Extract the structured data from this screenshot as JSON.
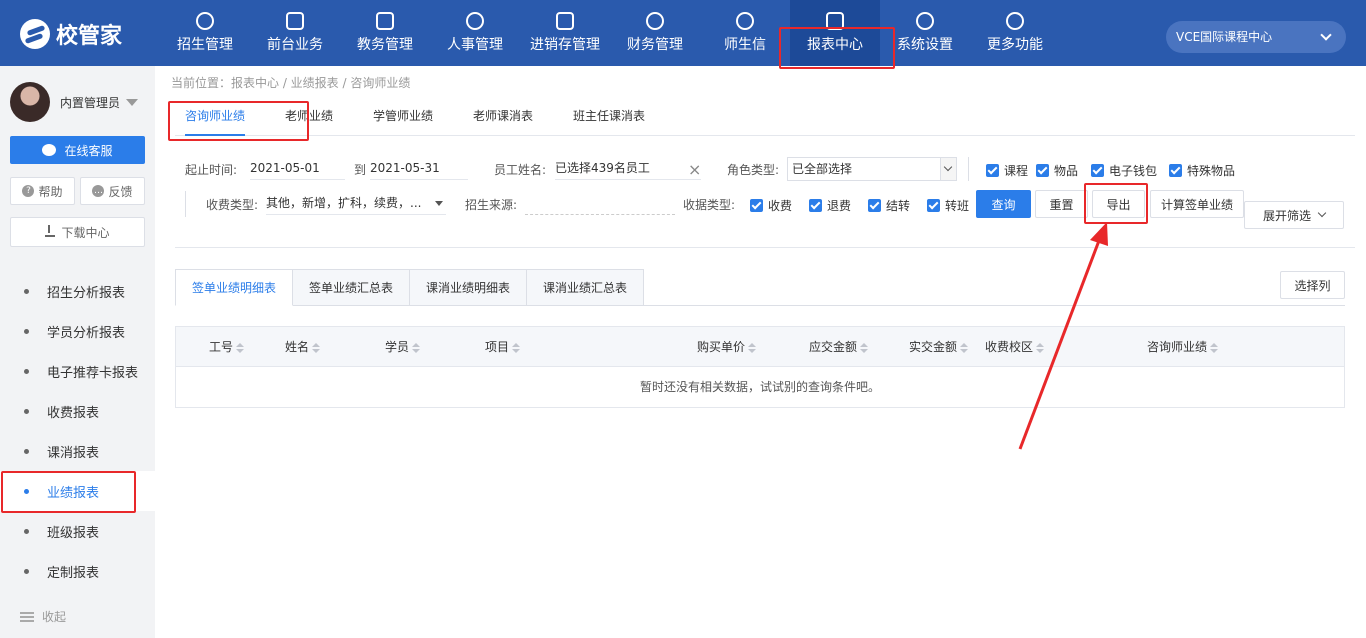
{
  "brand": {
    "name": "校管家"
  },
  "nav": {
    "items": [
      {
        "label": "招生管理",
        "icon": "person-add-icon"
      },
      {
        "label": "前台业务",
        "icon": "monitor-icon"
      },
      {
        "label": "教务管理",
        "icon": "book-icon"
      },
      {
        "label": "人事管理",
        "icon": "person-icon"
      },
      {
        "label": "进销存管理",
        "icon": "arrow-box-icon"
      },
      {
        "label": "财务管理",
        "icon": "yen-icon"
      },
      {
        "label": "师生信",
        "icon": "chat-bubble-icon"
      },
      {
        "label": "报表中心",
        "icon": "chart-icon"
      },
      {
        "label": "系统设置",
        "icon": "gear-icon"
      },
      {
        "label": "更多功能",
        "icon": "more-icon"
      }
    ],
    "active": "报表中心",
    "campus": "VCE国际课程中心"
  },
  "sidebar": {
    "user": "内置管理员",
    "service_button": "在线客服",
    "help": "帮助",
    "feedback": "反馈",
    "download": "下载中心",
    "menu": [
      "招生分析报表",
      "学员分析报表",
      "电子推荐卡报表",
      "收费报表",
      "课消报表",
      "业绩报表",
      "班级报表",
      "定制报表"
    ],
    "active_menu": "业绩报表",
    "collapse": "收起"
  },
  "breadcrumb": "当前位置：报表中心 / 业绩报表 / 咨询师业绩",
  "subtabs": [
    "咨询师业绩",
    "老师业绩",
    "学管师业绩",
    "老师课消表",
    "班主任课消表"
  ],
  "filters": {
    "date_label": "起止时间:",
    "date_from": "2021-05-01",
    "date_to_label": "到",
    "date_to": "2021-05-31",
    "staff_label": "员工姓名:",
    "staff_value": "已选择439名员工",
    "role_label": "角色类型:",
    "role_value": "已全部选择",
    "item_checks": [
      "课程",
      "物品",
      "电子钱包",
      "特殊物品"
    ],
    "fee_type_label": "收费类型:",
    "fee_type_value": "其他，新增，扩科，续费，...",
    "source_label": "招生来源:",
    "source_value": "",
    "data_type_label": "收据类型:",
    "data_type_checks": [
      "收费",
      "退费",
      "结转",
      "转班"
    ]
  },
  "buttons": {
    "query": "查询",
    "reset": "重置",
    "export": "导出",
    "calc": "计算签单业绩",
    "expand": "展开筛选",
    "choose_cols": "选择列"
  },
  "report_tabs": [
    "签单业绩明细表",
    "签单业绩汇总表",
    "课消业绩明细表",
    "课消业绩汇总表"
  ],
  "table": {
    "columns": [
      "工号",
      "姓名",
      "学员",
      "项目",
      "购买单价",
      "应交金额",
      "实交金额",
      "收费校区",
      "咨询师业绩"
    ],
    "empty_text": "暂时还没有相关数据，试试别的查询条件吧。"
  },
  "colors": {
    "primary": "#2b7de9",
    "header": "#2a5aad",
    "annotation": "#e8282a"
  }
}
